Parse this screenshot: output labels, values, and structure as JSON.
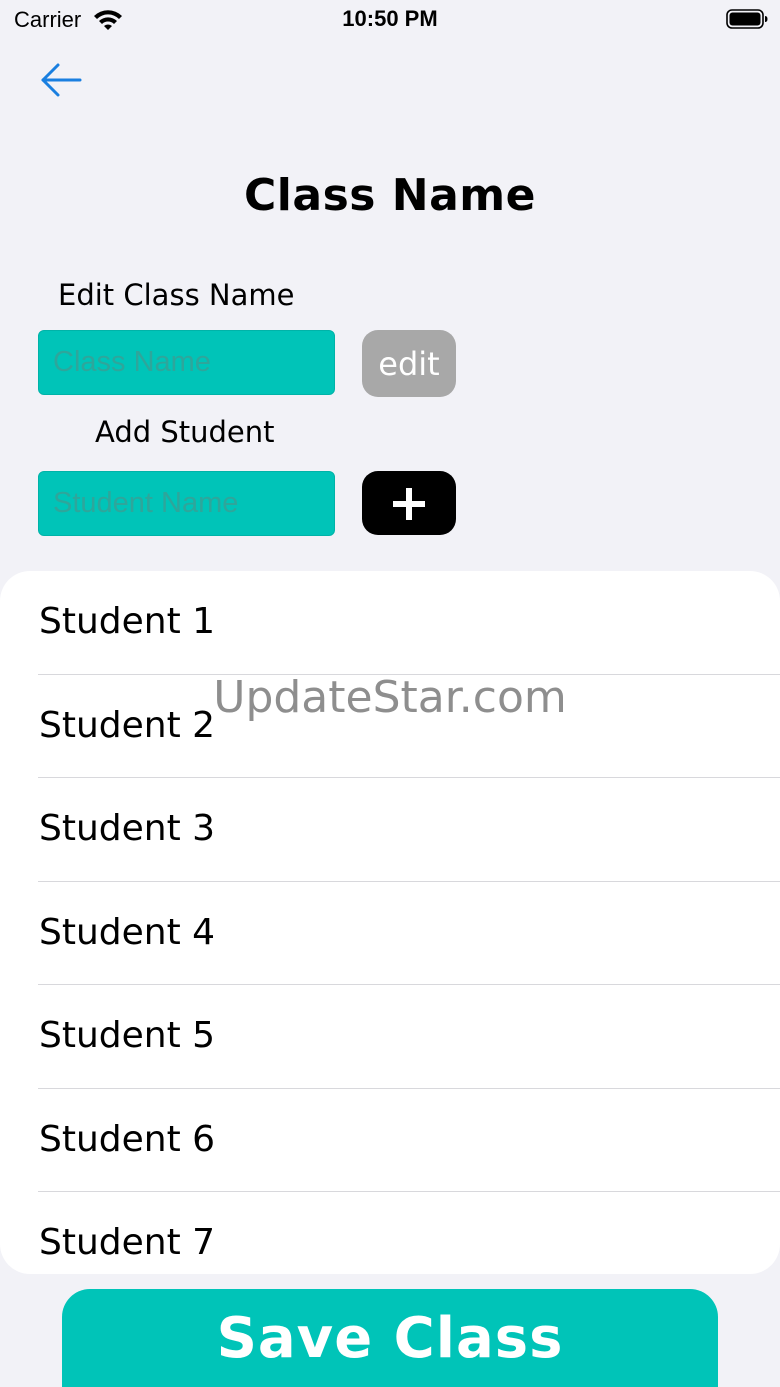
{
  "status_bar": {
    "carrier": "Carrier",
    "time": "10:50 PM"
  },
  "page": {
    "title": "Class Name"
  },
  "edit_class": {
    "label": "Edit Class Name",
    "placeholder": "Class Name",
    "value": "",
    "button_label": "edit"
  },
  "add_student": {
    "label": "Add Student",
    "placeholder": "Student Name",
    "value": ""
  },
  "students": [
    {
      "name": "Student 1"
    },
    {
      "name": "Student 2"
    },
    {
      "name": "Student 3"
    },
    {
      "name": "Student 4"
    },
    {
      "name": "Student 5"
    },
    {
      "name": "Student 6"
    },
    {
      "name": "Student 7"
    }
  ],
  "watermark": "UpdateStar.com",
  "save_button_label": "Save Class",
  "colors": {
    "accent": "#00c4b8",
    "back_arrow": "#1a7fe0",
    "edit_button": "#a8a8a8",
    "add_button": "#000000",
    "background": "#f2f2f7"
  },
  "icons": {
    "back": "arrow-left-icon",
    "add": "plus-icon",
    "wifi": "wifi-icon",
    "battery": "battery-icon"
  }
}
